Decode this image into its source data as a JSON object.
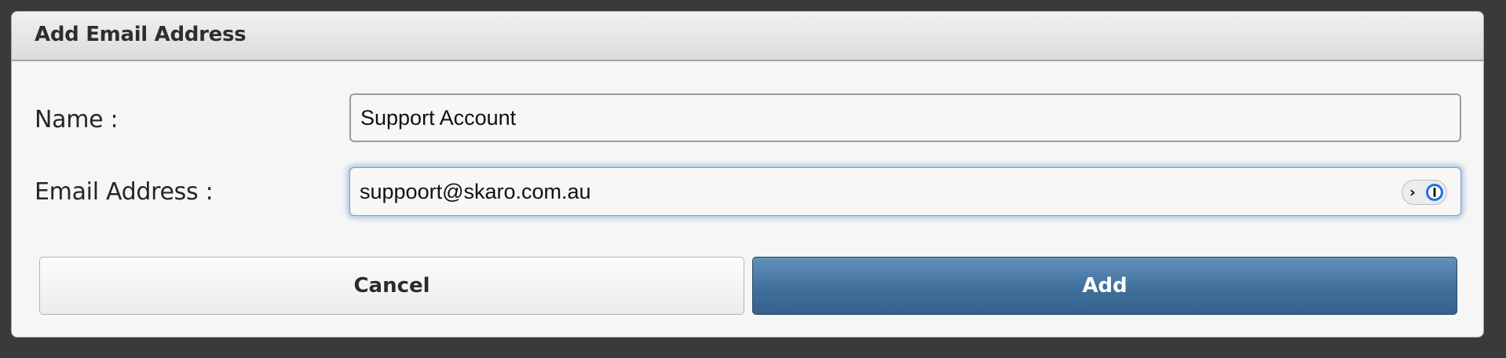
{
  "dialog": {
    "title": "Add Email Address"
  },
  "form": {
    "name_label": "Name :",
    "name_value": "Support Account",
    "email_label": "Email Address :",
    "email_value": "suppoort@skaro.com.au"
  },
  "password_manager": {
    "chevron": "›",
    "icon": "password-manager-icon",
    "accent_color": "#1a73e8"
  },
  "buttons": {
    "cancel_label": "Cancel",
    "add_label": "Add",
    "add_color": "#3f6f9c"
  },
  "colors": {
    "backdrop": "#3a3a3a",
    "dialog_background": "#f6f6f6",
    "focus_ring": "#6e96d2"
  }
}
